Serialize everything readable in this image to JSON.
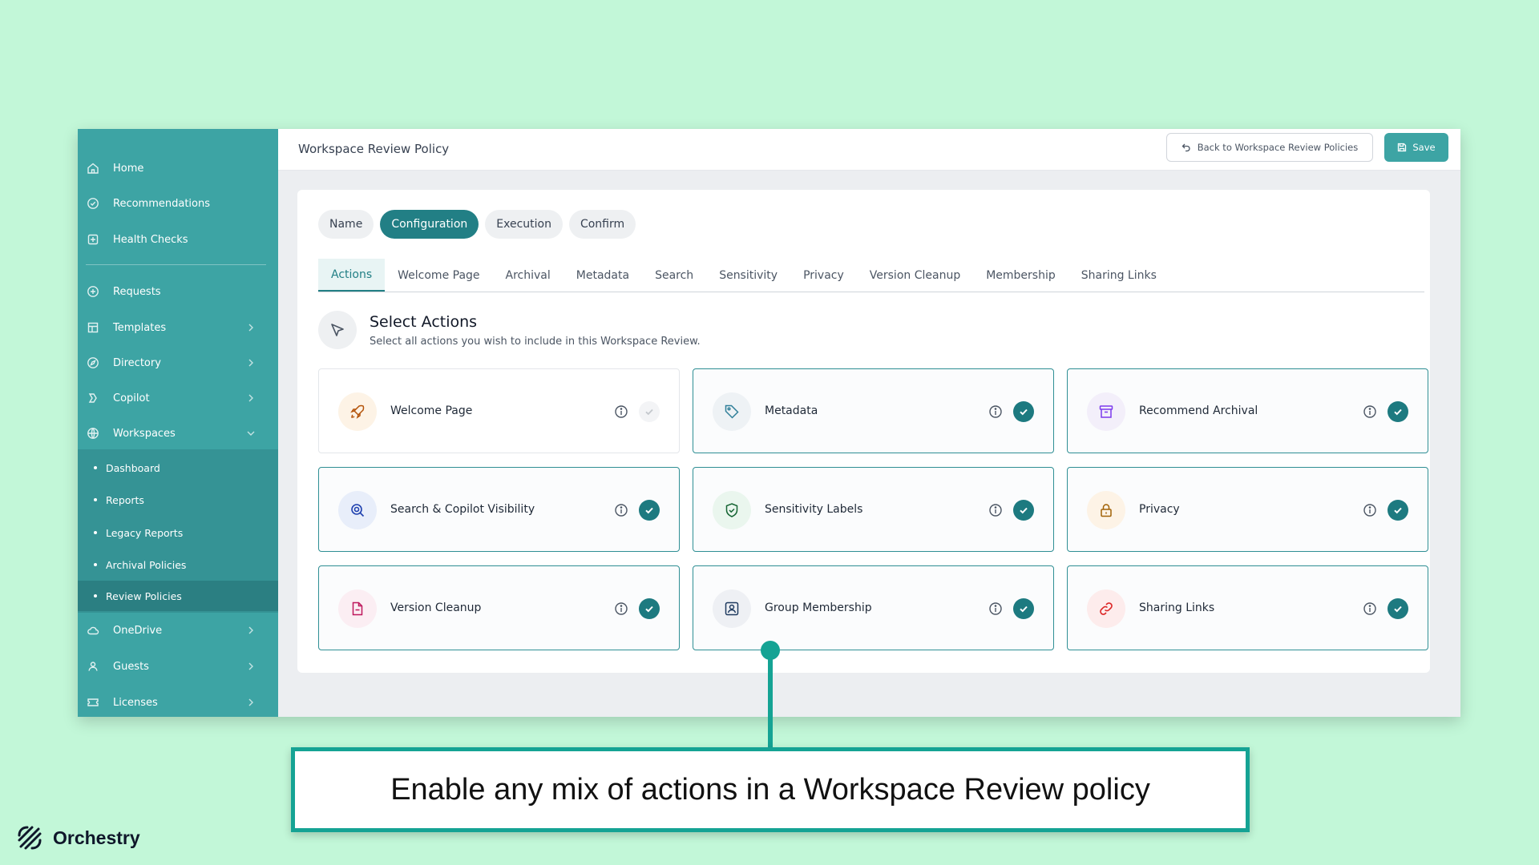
{
  "sidebar": {
    "items": [
      {
        "label": "Home",
        "icon": "home-icon"
      },
      {
        "label": "Recommendations",
        "icon": "recommendations-icon"
      },
      {
        "label": "Health Checks",
        "icon": "health-checks-icon"
      },
      {
        "label": "Requests",
        "icon": "requests-icon"
      },
      {
        "label": "Templates",
        "icon": "templates-icon"
      },
      {
        "label": "Directory",
        "icon": "directory-icon"
      },
      {
        "label": "Copilot",
        "icon": "copilot-icon"
      },
      {
        "label": "Workspaces",
        "icon": "workspaces-icon"
      },
      {
        "label": "OneDrive",
        "icon": "onedrive-icon"
      },
      {
        "label": "Guests",
        "icon": "guests-icon"
      },
      {
        "label": "Licenses",
        "icon": "licenses-icon"
      }
    ],
    "workspaces_sub": [
      "Dashboard",
      "Reports",
      "Legacy Reports",
      "Archival Policies",
      "Review Policies"
    ]
  },
  "header": {
    "title": "Workspace Review Policy",
    "back_label": "Back to Workspace Review Policies",
    "save_label": "Save"
  },
  "steps": [
    "Name",
    "Configuration",
    "Execution",
    "Confirm"
  ],
  "tabs": [
    "Actions",
    "Welcome Page",
    "Archival",
    "Metadata",
    "Search",
    "Sensitivity",
    "Privacy",
    "Version Cleanup",
    "Membership",
    "Sharing Links"
  ],
  "section": {
    "title": "Select Actions",
    "subtitle": "Select all actions you wish to include in this Workspace Review."
  },
  "actions": [
    {
      "label": "Welcome Page",
      "enabled": false,
      "icon": "rocket-icon"
    },
    {
      "label": "Metadata",
      "enabled": true,
      "icon": "tag-icon"
    },
    {
      "label": "Recommend Archival",
      "enabled": true,
      "icon": "archive-icon"
    },
    {
      "label": "Search & Copilot Visibility",
      "enabled": true,
      "icon": "search-eye-icon"
    },
    {
      "label": "Sensitivity Labels",
      "enabled": true,
      "icon": "shield-check-icon"
    },
    {
      "label": "Privacy",
      "enabled": true,
      "icon": "lock-icon"
    },
    {
      "label": "Version Cleanup",
      "enabled": true,
      "icon": "file-cleanup-icon"
    },
    {
      "label": "Group Membership",
      "enabled": true,
      "icon": "group-membership-icon"
    },
    {
      "label": "Sharing Links",
      "enabled": true,
      "icon": "link-icon"
    }
  ],
  "callout": {
    "text": "Enable any mix of actions in a Workspace Review policy"
  },
  "brand": {
    "name": "Orchestry"
  },
  "colors": {
    "accent": "#227f85",
    "sidebar": "#3da4a4",
    "callout": "#15a394",
    "background": "#c2f7d8"
  }
}
